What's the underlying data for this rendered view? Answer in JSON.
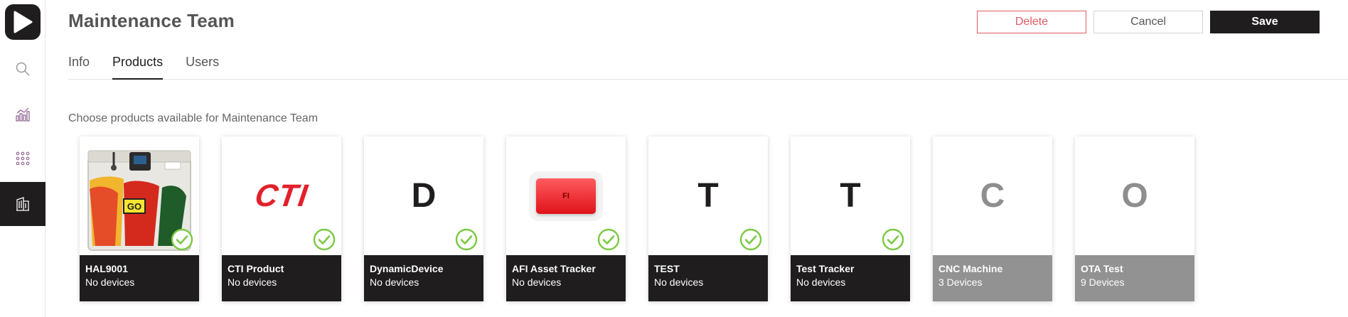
{
  "header": {
    "title": "Maintenance Team",
    "delete_label": "Delete",
    "cancel_label": "Cancel",
    "save_label": "Save"
  },
  "tabs": [
    {
      "label": "Info",
      "active": false
    },
    {
      "label": "Products",
      "active": true
    },
    {
      "label": "Users",
      "active": false
    }
  ],
  "sidebar": {
    "items": [
      {
        "icon": "search-icon",
        "active": false
      },
      {
        "icon": "analytics-icon",
        "active": false
      },
      {
        "icon": "apps-grid-icon",
        "active": false
      },
      {
        "icon": "organization-icon",
        "active": true
      }
    ]
  },
  "content": {
    "subtitle": "Choose products available for Maintenance Team"
  },
  "products": [
    {
      "name": "HAL9001",
      "count": "No devices",
      "image": "device-photo",
      "selected": true,
      "enabled": true
    },
    {
      "name": "CTI Product",
      "count": "No devices",
      "image": "cti-logo",
      "logo_text": "CTI",
      "selected": true,
      "enabled": true
    },
    {
      "name": "DynamicDevice",
      "count": "No devices",
      "letter": "D",
      "selected": true,
      "enabled": true
    },
    {
      "name": "AFI Asset Tracker",
      "count": "No devices",
      "image": "tracker-photo",
      "logo_text": "FI",
      "selected": true,
      "enabled": true
    },
    {
      "name": "TEST",
      "count": "No devices",
      "letter": "T",
      "selected": true,
      "enabled": true
    },
    {
      "name": "Test Tracker",
      "count": "No devices",
      "letter": "T",
      "selected": true,
      "enabled": true
    },
    {
      "name": "CNC Machine",
      "count": "3 Devices",
      "letter": "C",
      "selected": false,
      "enabled": false
    },
    {
      "name": "OTA Test",
      "count": "9 Devices",
      "letter": "O",
      "selected": false,
      "enabled": false
    }
  ],
  "colors": {
    "primary": "#1f1d1e",
    "danger": "#e15b64",
    "check": "#7ac943",
    "disabled": "#929292"
  }
}
